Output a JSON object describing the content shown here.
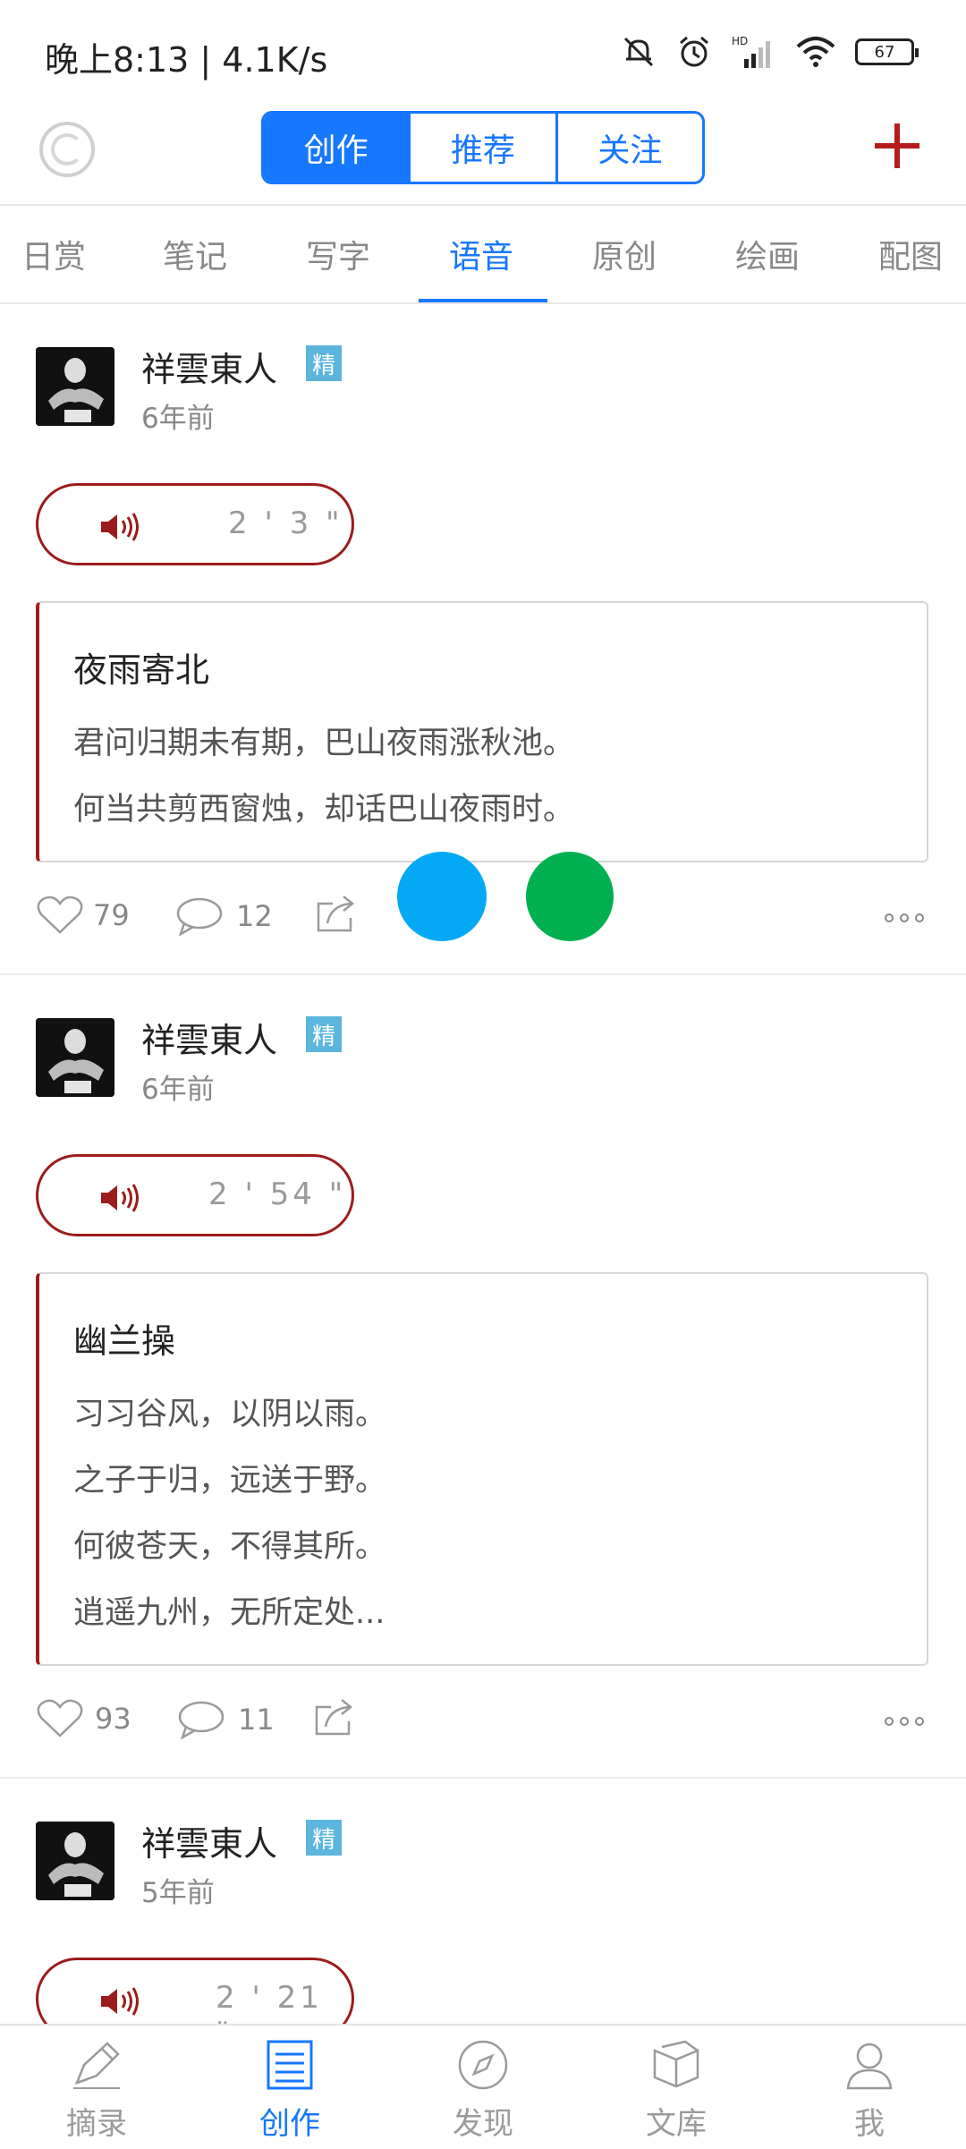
{
  "status_bar": {
    "time_speed": "晚上8:13 | 4.1K/s",
    "battery": "67",
    "icons": [
      "mute-bell-icon",
      "alarm-icon",
      "hd-signal-icon",
      "wifi-icon",
      "battery-icon"
    ]
  },
  "top_bar": {
    "segments": [
      "创作",
      "推荐",
      "关注"
    ],
    "active_segment": "创作",
    "accent_color": "#1677ff",
    "plus_color": "#b71c1c"
  },
  "category_tabs": {
    "items": [
      "日赏",
      "笔记",
      "写字",
      "语音",
      "原创",
      "绘画",
      "配图"
    ],
    "active": "语音"
  },
  "posts": [
    {
      "author": "祥雲東人",
      "badge": "精",
      "time": "6年前",
      "duration": "2 ' 3 \"",
      "poem_title": "夜雨寄北",
      "poem_lines": [
        "君问归期未有期，巴山夜雨涨秋池。",
        "何当共剪西窗烛，却话巴山夜雨时。"
      ],
      "likes": "79",
      "comments": "12"
    },
    {
      "author": "祥雲東人",
      "badge": "精",
      "time": "6年前",
      "duration": "2 ' 54 \"",
      "poem_title": "幽兰操",
      "poem_lines": [
        "习习谷风，以阴以雨。",
        "之子于归，远送于野。",
        "何彼苍天，不得其所。",
        "逍遥九州，无所定处..."
      ],
      "likes": "93",
      "comments": "11"
    },
    {
      "author": "祥雲東人",
      "badge": "精",
      "time": "5年前",
      "duration": "2 ' 21 \""
    }
  ],
  "floating": {
    "blue": "#03a9f4",
    "green": "#00b050"
  },
  "bottom_nav": {
    "items": [
      "摘录",
      "创作",
      "发现",
      "文库",
      "我"
    ],
    "active": "创作"
  }
}
